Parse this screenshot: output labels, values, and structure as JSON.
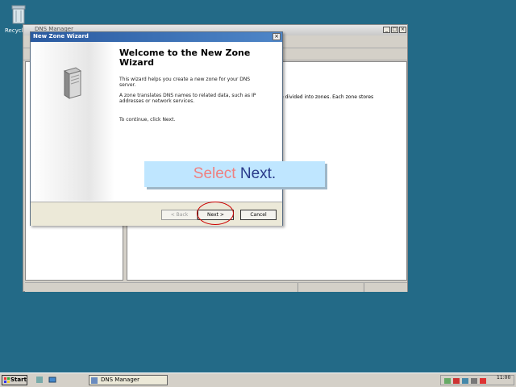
{
  "desktop": {
    "recycle_label": "Recycle"
  },
  "dns_window": {
    "title": "DNS Manager",
    "description": "e divided into zones. Each zone stores"
  },
  "wizard": {
    "title": "New Zone Wizard",
    "close": "×",
    "heading": "Welcome to the New Zone Wizard",
    "p1": "This wizard helps you create a new zone for your DNS server.",
    "p2": "A zone translates DNS names to related data, such as IP addresses or network services.",
    "p3": "To continue, click Next.",
    "back_label": "< Back",
    "next_label": "Next >",
    "cancel_label": "Cancel"
  },
  "callout": {
    "part1": "Select ",
    "part2": "Next."
  },
  "taskbar": {
    "start_label": "Start",
    "task_label": "DNS Manager",
    "clock": "11:00"
  },
  "colors": {
    "desktop": "#236a87",
    "callout_bg": "#bfe6ff",
    "highlight": "#cc0000"
  }
}
